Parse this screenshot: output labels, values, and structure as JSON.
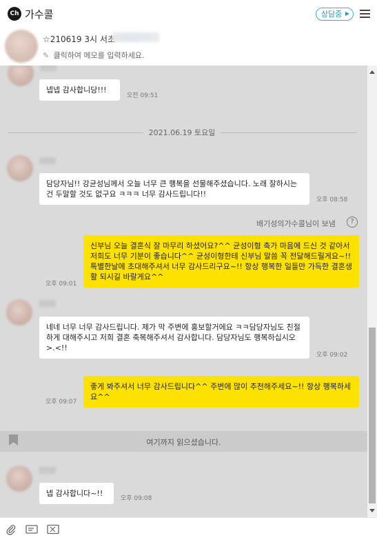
{
  "app": {
    "logo": "Ch",
    "title": "가수콜"
  },
  "header": {
    "consult_label": "상담중"
  },
  "profile": {
    "name": "☆210619 3시 서초",
    "memo_placeholder": "클릭하여 메모를 입력하세요."
  },
  "chat": {
    "messages": [
      {
        "side": "in",
        "text": "넵넵 감사합니당!!!",
        "time": "오전 09:51"
      },
      {
        "side": "in",
        "text": "담당자님!! 강균성님께서 오늘 너무 큰 행복을 선물해주셨습니다. 노래 잘하시는건 두말할 것도 없구요 ㅋㅋㅋ 너무 감사드립니다!!",
        "time": "오후 08:58"
      },
      {
        "side": "out",
        "text": "신부님 오늘 결혼식 잘 마무리 하셨어요?^^ 균성이형 축가 마음에 드신 것 같아서 저희도 너무 기분이 좋습니다^^ 균성이형한테 신부님 말씀 꼭 전달해드릴게요~!! 특별한날에 초대해주셔서 너무 감사드리구요~!! 항상 행복한 일들만 가득한 결혼생활 되시길 바랄게요^^",
        "time": "오후 09:01"
      },
      {
        "side": "in",
        "text": "네네 너무 너무 감사드립니다. 제가 막 주변에 홍보할거에요 ㅋㅋ담당자님도 친절하게 대해주시고 저희 결혼 축복해주셔서 감사합니다. 담당자님도 행복하십시오>.<!!",
        "time": "오후 09:02"
      },
      {
        "side": "out",
        "text": "좋게 봐주셔서 너무 감사드립니다^^ 주변에 많이 추천해주세요~!! 항상 행복하세요^^",
        "time": "오후 09:07"
      },
      {
        "side": "in",
        "text": "넵 감사합니다~!!",
        "time": "오후 09:08"
      }
    ],
    "date_divider": "2021.06.19 토요일",
    "sent_by": "배기성의가수콜님이 보냄",
    "read_marker": "여기까지 읽으셨습니다."
  },
  "toolbar": {
    "icons": [
      "paperclip-icon",
      "template-icon",
      "emoticon-icon"
    ]
  },
  "colors": {
    "chat_bg": "#dadada",
    "outgoing_bubble": "#fde200",
    "accent": "#1a9ccd"
  }
}
